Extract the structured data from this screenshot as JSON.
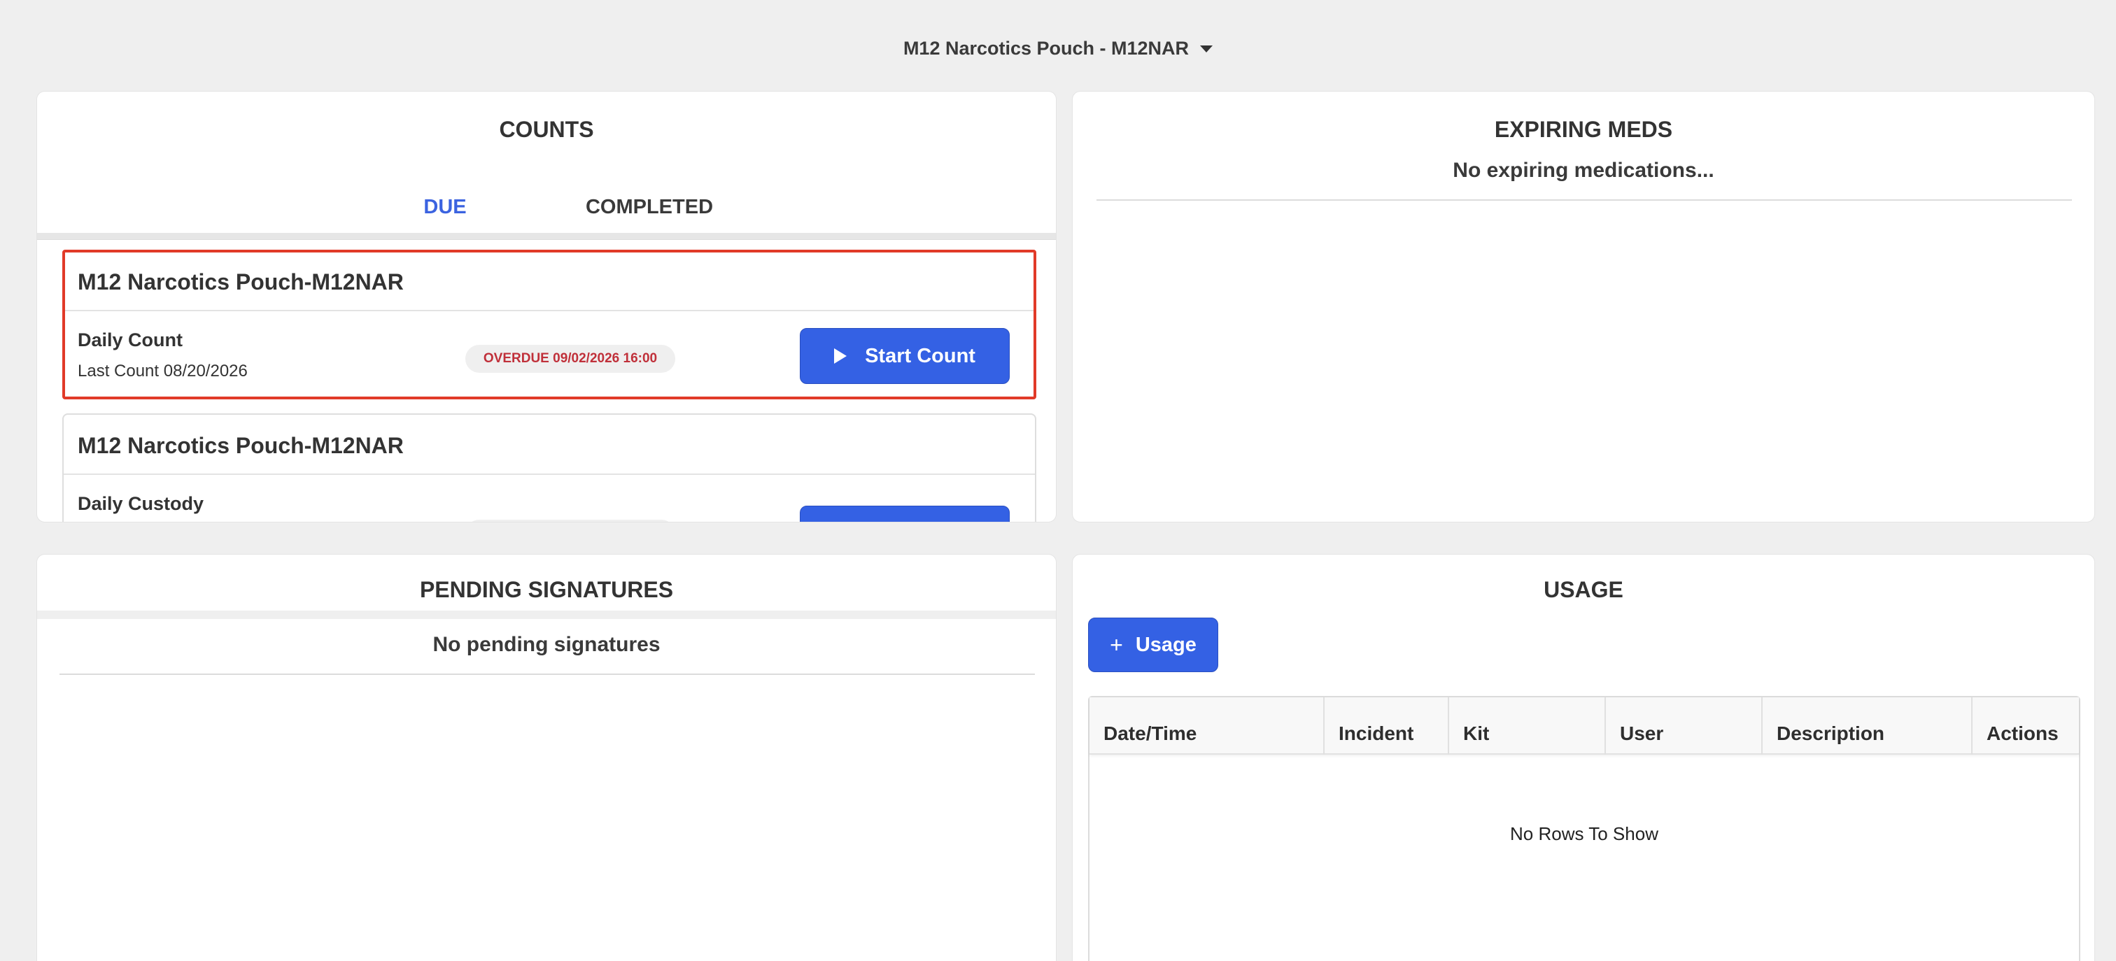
{
  "header": {
    "selector_label": "M12 Narcotics Pouch - M12NAR"
  },
  "counts": {
    "title": "COUNTS",
    "tabs": [
      {
        "label": "DUE",
        "active": true
      },
      {
        "label": "COMPLETED",
        "active": false
      }
    ],
    "cards": [
      {
        "title": "M12 Narcotics Pouch-M12NAR",
        "type": "Daily Count",
        "last_count": "Last Count  08/20/2026",
        "badge": "OVERDUE 09/02/2026 16:00",
        "button": "Start Count"
      },
      {
        "title": "M12 Narcotics Pouch-M12NAR",
        "type": "Daily Custody"
      }
    ]
  },
  "expiring": {
    "title": "EXPIRING MEDS",
    "empty_message": "No expiring medications..."
  },
  "pending": {
    "title": "PENDING SIGNATURES",
    "empty_message": "No pending signatures"
  },
  "usage": {
    "title": "USAGE",
    "add_button": "Usage",
    "columns": [
      "Date/Time",
      "Incident",
      "Kit",
      "User",
      "Description",
      "Actions"
    ],
    "empty_message": "No Rows To Show"
  },
  "colors": {
    "accent": "#3461e4",
    "overdue_text": "#c0303a",
    "highlight_border": "#e13a28",
    "background": "#efefef"
  }
}
